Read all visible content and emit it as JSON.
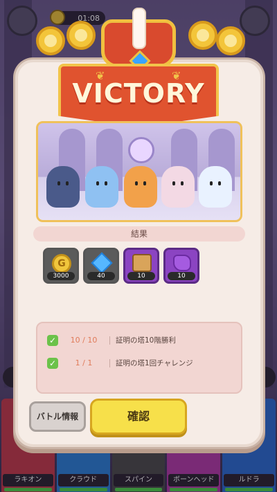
{
  "hud": {
    "timer": "01:08"
  },
  "modal": {
    "title": "VICTORY",
    "section_label": "結果",
    "rewards": [
      {
        "type": "gold",
        "icon": "gold-coin-icon",
        "coin_letter": "G",
        "qty": "3000"
      },
      {
        "type": "gem",
        "icon": "blue-diamond-icon",
        "qty": "40"
      },
      {
        "type": "hero-piece",
        "icon": "hero-puzzle-piece-icon",
        "qty": "10"
      },
      {
        "type": "ore",
        "icon": "purple-ore-icon",
        "qty": "10"
      }
    ],
    "missions": [
      {
        "progress": "10 / 10",
        "text": "証明の塔10階勝利"
      },
      {
        "progress": "1 / 1",
        "text": "証明の塔1回チャレンジ"
      }
    ],
    "buttons": {
      "battle_info": "バトル情報",
      "confirm": "確認"
    }
  },
  "party": [
    {
      "name": "ラキオン",
      "color": "#c23a4a"
    },
    {
      "name": "クラウド",
      "color": "#2a7fd6"
    },
    {
      "name": "スパイン",
      "color": "#4a4a4a"
    },
    {
      "name": "ボーンヘッド",
      "color": "#b13aa6"
    },
    {
      "name": "ルドラ",
      "color": "#2a6ad0"
    }
  ],
  "colors": {
    "victory_banner": "#e0532f",
    "confirm_button": "#f7e04a",
    "check_green": "#6cc24a"
  }
}
